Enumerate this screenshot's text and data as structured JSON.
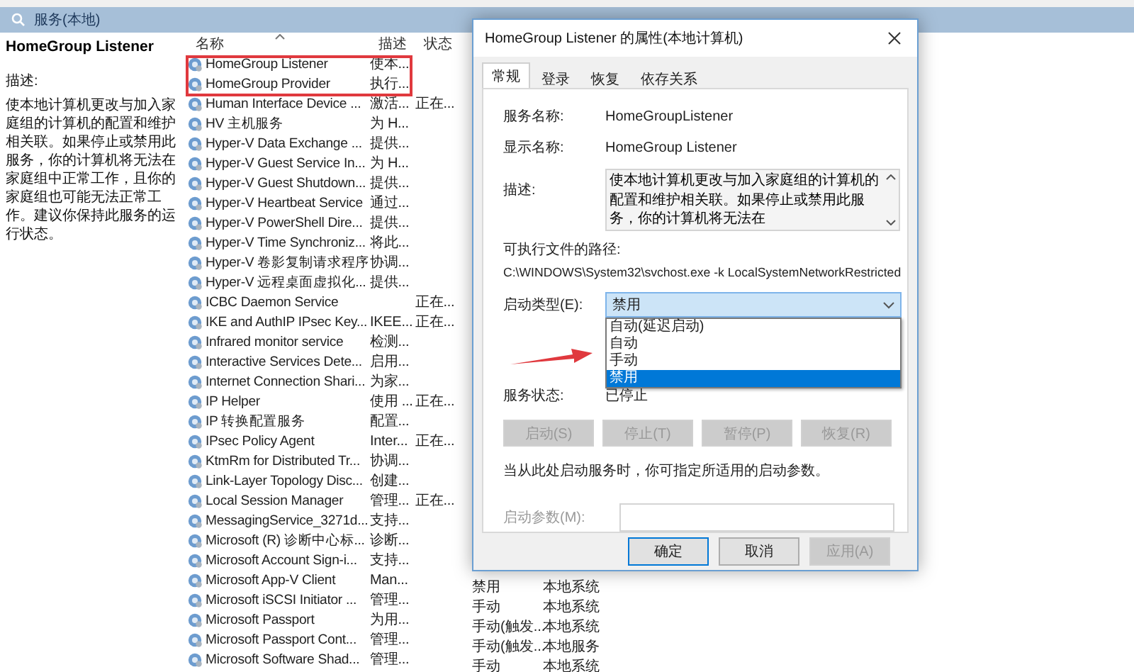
{
  "header": {
    "title": "服务(本地)"
  },
  "details": {
    "service_name": "HomeGroup Listener",
    "description_label": "描述:",
    "description": "使本地计算机更改与加入家庭组的计算机的配置和维护相关联。如果停止或禁用此服务，你的计算机将无法在家庭组中正常工作，且你的家庭组也可能无法正常工作。建议你保持此服务的运行状态。"
  },
  "table": {
    "columns": [
      "名称",
      "描述",
      "状态"
    ],
    "rows": [
      {
        "name": "HomeGroup Listener",
        "description": "使本..."
      },
      {
        "name": "HomeGroup Provider",
        "description": "执行..."
      },
      {
        "name": "Human Interface Device ...",
        "description": "激活...",
        "status": "正在..."
      },
      {
        "name": "HV 主机服务",
        "description": "为 H..."
      },
      {
        "name": "Hyper-V Data Exchange ...",
        "description": "提供..."
      },
      {
        "name": "Hyper-V Guest Service In...",
        "description": "为 H..."
      },
      {
        "name": "Hyper-V Guest Shutdown...",
        "description": "提供..."
      },
      {
        "name": "Hyper-V Heartbeat Service",
        "description": "通过..."
      },
      {
        "name": "Hyper-V PowerShell Dire...",
        "description": "提供..."
      },
      {
        "name": "Hyper-V Time Synchroniz...",
        "description": "将此..."
      },
      {
        "name": "Hyper-V 卷影复制请求程序",
        "description": "协调..."
      },
      {
        "name": "Hyper-V 远程桌面虚拟化...",
        "description": "提供..."
      },
      {
        "name": "ICBC Daemon Service",
        "status": "正在..."
      },
      {
        "name": "IKE and AuthIP IPsec Key...",
        "description": "IKEE...",
        "status": "正在..."
      },
      {
        "name": "Infrared monitor service",
        "description": "检测..."
      },
      {
        "name": "Interactive Services Dete...",
        "description": "启用..."
      },
      {
        "name": "Internet Connection Shari...",
        "description": "为家..."
      },
      {
        "name": "IP Helper",
        "description": "使用 ...",
        "status": "正在..."
      },
      {
        "name": "IP 转换配置服务",
        "description": "配置..."
      },
      {
        "name": "IPsec Policy Agent",
        "description": "Inter...",
        "status": "正在..."
      },
      {
        "name": "KtmRm for Distributed Tr...",
        "description": "协调..."
      },
      {
        "name": "Link-Layer Topology Disc...",
        "description": "创建..."
      },
      {
        "name": "Local Session Manager",
        "description": "管理...",
        "status": "正在..."
      },
      {
        "name": "MessagingService_3271d...",
        "description": "支持..."
      },
      {
        "name": "Microsoft (R) 诊断中心标...",
        "description": "诊断..."
      },
      {
        "name": "Microsoft Account Sign-i...",
        "description": "支持..."
      },
      {
        "name": "Microsoft App-V Client",
        "description": "Man...",
        "startup_type": "禁用",
        "logon_as": "本地系统"
      },
      {
        "name": "Microsoft iSCSI Initiator ...",
        "description": "管理...",
        "startup_type": "手动",
        "logon_as": "本地系统"
      },
      {
        "name": "Microsoft Passport",
        "description": "为用...",
        "startup_type": "手动(触发...",
        "logon_as": "本地系统"
      },
      {
        "name": "Microsoft Passport Cont...",
        "description": "管理...",
        "startup_type": "手动(触发...",
        "logon_as": "本地服务"
      },
      {
        "name": "Microsoft Software Shad...",
        "description": "管理...",
        "startup_type": "手动",
        "logon_as": "本地系统"
      }
    ]
  },
  "dialog": {
    "title": "HomeGroup Listener 的属性(本地计算机)",
    "tabs": [
      {
        "label": "常规",
        "selected": true
      },
      {
        "label": "登录",
        "selected": false
      },
      {
        "label": "恢复",
        "selected": false
      },
      {
        "label": "依存关系",
        "selected": false
      }
    ],
    "fields": [
      {
        "label": "服务名称:",
        "value": "HomeGroupListener"
      },
      {
        "label": "显示名称:",
        "value": "HomeGroup Listener"
      }
    ],
    "description_label": "描述:",
    "description": "使本地计算机更改与加入家庭组的计算机的配置和维护相关联。如果停止或禁用此服务，你的计算机将无法在",
    "path_label": "可执行文件的路径:",
    "path": "C:\\WINDOWS\\System32\\svchost.exe -k LocalSystemNetworkRestricted",
    "startup_label": "启动类型(E):",
    "startup_value": "禁用",
    "startup_options": [
      {
        "label": "自动(延迟启动)",
        "selected": false
      },
      {
        "label": "自动",
        "selected": false
      },
      {
        "label": "手动",
        "selected": false
      },
      {
        "label": "禁用",
        "selected": true
      }
    ],
    "status_label": "服务状态:",
    "status_value": "已停止",
    "service_buttons": [
      {
        "label": "启动(S)",
        "disabled": true
      },
      {
        "label": "停止(T)",
        "disabled": true
      },
      {
        "label": "暂停(P)",
        "disabled": true
      },
      {
        "label": "恢复(R)",
        "disabled": true
      }
    ],
    "hint": "当从此处启动服务时，你可指定所适用的启动参数。",
    "params": {
      "label": "启动参数(M):",
      "disabled": true
    },
    "footer_buttons": [
      {
        "label": "确定",
        "disabled": false,
        "default": true
      },
      {
        "label": "取消",
        "disabled": false,
        "default": false
      },
      {
        "label": "应用(A)",
        "disabled": true,
        "default": false
      }
    ]
  }
}
